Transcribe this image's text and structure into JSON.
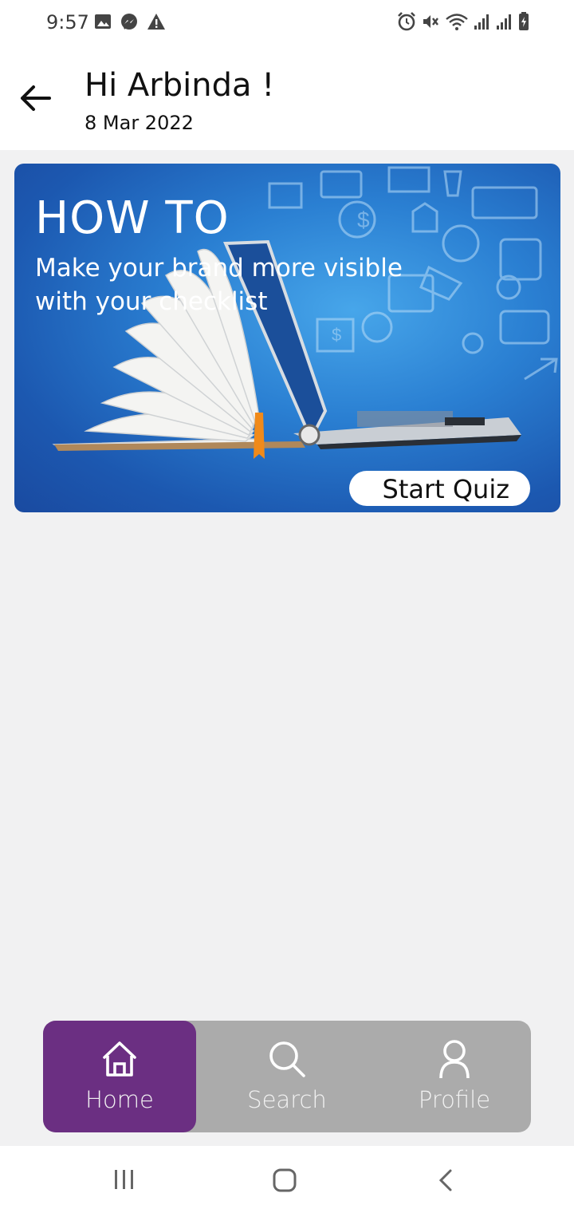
{
  "status_bar": {
    "time": "9:57",
    "left_icons": [
      "gallery-icon",
      "messenger-icon",
      "warning-icon"
    ],
    "right_icons": [
      "alarm-icon",
      "mute-icon",
      "wifi-icon",
      "signal-icon",
      "signal-icon",
      "battery-charging-icon"
    ]
  },
  "header": {
    "greeting": "Hi Arbinda !",
    "date": "8 Mar 2022"
  },
  "banner": {
    "title": "HOW TO",
    "subtitle": "Make your brand more visible with your checklist",
    "button_label": "Start Quiz"
  },
  "bottom_nav": {
    "items": [
      {
        "label": "Home",
        "icon": "home-icon",
        "active": true
      },
      {
        "label": "Search",
        "icon": "search-icon",
        "active": false
      },
      {
        "label": "Profile",
        "icon": "profile-icon",
        "active": false
      }
    ],
    "active_color": "#6b2f82",
    "bar_color": "#ababab"
  },
  "system_nav": [
    "recents-icon",
    "home-circle-icon",
    "back-chevron-icon"
  ]
}
